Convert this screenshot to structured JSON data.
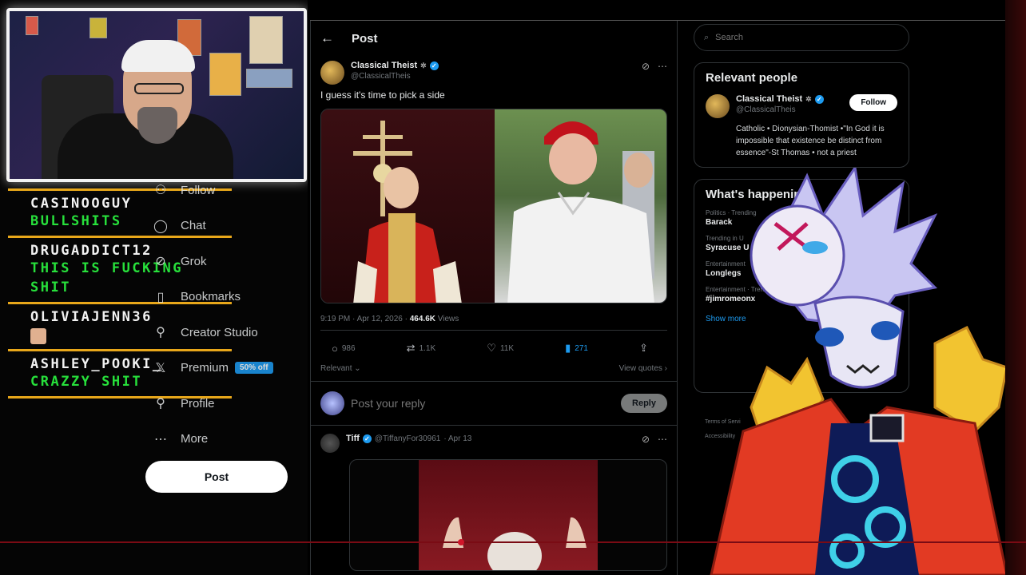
{
  "chat": {
    "messages": [
      {
        "user": "CASINOOGUY",
        "message": "BULLSHITS"
      },
      {
        "user": "DRUGADDICT12",
        "message": "THIS IS FUCKING SHIT"
      },
      {
        "user": "OLIVIAJENN36",
        "message": ""
      },
      {
        "user": "ASHLEY_POOKI_",
        "message": "CRAZZY SHIT"
      }
    ]
  },
  "nav": {
    "items": [
      {
        "label": "Follow",
        "icon": "follow-icon"
      },
      {
        "label": "Chat",
        "icon": "chat-icon"
      },
      {
        "label": "Grok",
        "icon": "grok-icon"
      },
      {
        "label": "Bookmarks",
        "icon": "bookmark-icon"
      },
      {
        "label": "Creator Studio",
        "icon": "creator-studio-icon"
      },
      {
        "label": "Premium",
        "icon": "x-logo-icon",
        "badge": "50% off"
      },
      {
        "label": "Profile",
        "icon": "profile-icon"
      },
      {
        "label": "More",
        "icon": "more-icon"
      }
    ],
    "post_label": "Post"
  },
  "feed": {
    "header_title": "Post",
    "tweet": {
      "display_name": "Classical Theist",
      "handle": "@ClassicalTheis",
      "text": "I guess it's time to pick a side",
      "time": "9:19 PM · Apr 12, 2026 ·",
      "views_count": "464.6K",
      "views_label": "Views",
      "replies": "986",
      "reposts": "1.1K",
      "likes": "11K",
      "bookmarks": "271",
      "relevant_label": "Relevant",
      "view_quotes_label": "View quotes"
    },
    "reply_placeholder": "Post your reply",
    "reply_button": "Reply",
    "reply_tweet": {
      "display_name": "Tiff",
      "handle": "@TiffanyFor30961",
      "date": "· Apr 13"
    }
  },
  "sidebar": {
    "search_placeholder": "Search",
    "relevant_title": "Relevant people",
    "person": {
      "display_name": "Classical Theist",
      "handle": "@ClassicalTheis",
      "follow_label": "Follow",
      "bio": "Catholic • Dionysian-Thomist •\"In God it is impossible that existence be distinct from essence\"-St Thomas • not a priest"
    },
    "happening_title": "What's happening",
    "trends": [
      {
        "category": "Politics · Trending",
        "name": "Barack"
      },
      {
        "category": "Trending in U",
        "name": "Syracuse U"
      },
      {
        "category": "Entertainment",
        "name": "Longlegs"
      },
      {
        "category": "Entertainment · Trending",
        "name": "#jimromeonx"
      }
    ],
    "show_more": "Show more",
    "footer": [
      "Terms of Servi",
      "Accessibility"
    ]
  },
  "colors": {
    "accent": "#1d9bf0",
    "chat_divider": "#e8a71a",
    "chat_message": "#27e03b",
    "background": "#000000"
  }
}
